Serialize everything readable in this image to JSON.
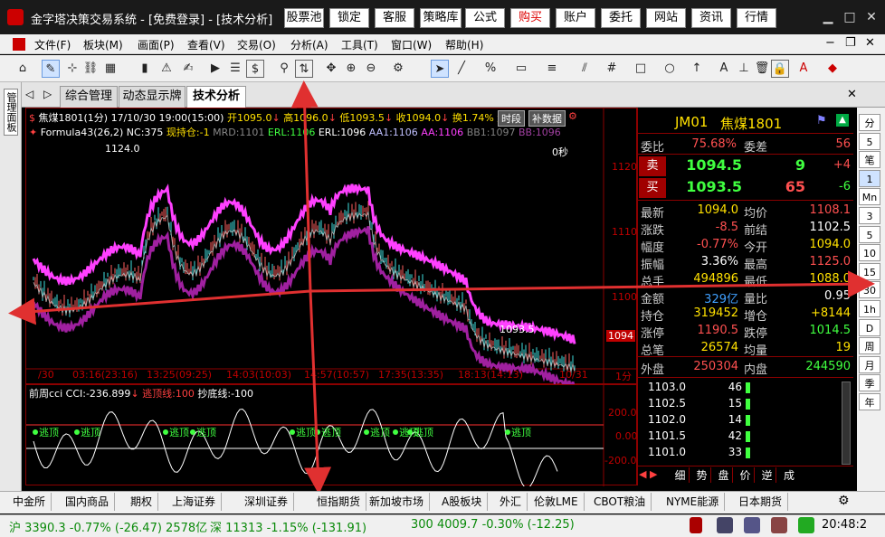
{
  "titlebar": {
    "title": "金字塔决策交易系统 - [免费登录] - [技术分析]",
    "buttons": [
      "股票池",
      "锁定",
      "客服",
      "策略库",
      "公式",
      "购买",
      "账户",
      "委托",
      "网站",
      "资讯",
      "行情"
    ]
  },
  "menu": [
    "文件(F)",
    "板块(M)",
    "画面(P)",
    "查看(V)",
    "交易(O)",
    "分析(A)",
    "工具(T)",
    "窗口(W)",
    "帮助(H)"
  ],
  "tabs": [
    "综合管理",
    "动态显示牌",
    "技术分析"
  ],
  "left_strip_label": "管理面板",
  "chart": {
    "header": "焦煤1801(1分)  17/10/30 19:00(15:00)",
    "open": "开1095.0",
    "high": "高1096.0",
    "low": "低1093.5",
    "close": "收1094.0",
    "turnover": "换1.74%",
    "qty_label": "量",
    "btn_timeshare": "时段",
    "btn_fill": "补数据",
    "formula_line": "Formula43(26,2)",
    "nc": "NC:375",
    "pos": "现持仓:-1",
    "mrd": "MRD:1101",
    "erl": "ERL:1106",
    "erl2": "ERL:1096",
    "aa1": "AA1:1106",
    "aa": "AA:1106",
    "bb1": "BB1:1097",
    "bb": "BB:1096",
    "peak_label": "1124.0",
    "low_label": "1093.5",
    "countdown": "0秒",
    "price_ticks": [
      "1120",
      "1110",
      "1100"
    ],
    "last_price_tag": "1094",
    "time_ticks": [
      "/30",
      "03:16(23:16)",
      "13:25(09:25)",
      "14:03(10:03)",
      "14:57(10:57)",
      "17:35(13:35)",
      "18:13(14:13)",
      "10/31"
    ],
    "period_unit": "1分"
  },
  "cci": {
    "title": "前周cci",
    "value": "CCI:-236.899",
    "escape": "逃顶线:100",
    "bottom": "抄底线:-100",
    "ticks": [
      "200.00",
      "0.00",
      "-200.00"
    ],
    "escape_label": "逃顶"
  },
  "quote": {
    "code": "JM01",
    "name": "焦煤1801",
    "weibi_lbl": "委比",
    "weibi": "75.68%",
    "weicha_lbl": "委差",
    "weicha": "56",
    "sell_lbl": "卖",
    "sell_price": "1094.5",
    "sell_vol": "9",
    "sell_chg": "+4",
    "buy_lbl": "买",
    "buy_price": "1093.5",
    "buy_vol": "65",
    "buy_chg": "-6",
    "rows": [
      {
        "l1": "最新",
        "v1": "1094.0",
        "l2": "均价",
        "v2": "1108.1",
        "c1": "#ffe000",
        "c2": "#ff5050"
      },
      {
        "l1": "涨跌",
        "v1": "-8.5",
        "l2": "前结",
        "v2": "1102.5",
        "c1": "#ff5050",
        "c2": "#ffffff"
      },
      {
        "l1": "幅度",
        "v1": "-0.77%",
        "l2": "今开",
        "v2": "1094.0",
        "c1": "#ff5050",
        "c2": "#ffe000"
      },
      {
        "l1": "振幅",
        "v1": "3.36%",
        "l2": "最高",
        "v2": "1125.0",
        "c1": "#ffffff",
        "c2": "#ff5050"
      },
      {
        "l1": "总手",
        "v1": "494896",
        "l2": "最低",
        "v2": "1088.0",
        "c1": "#ffe000",
        "c2": "#ffe000"
      },
      {
        "l1": "金额",
        "v1": "329亿",
        "l2": "量比",
        "v2": "0.95",
        "c1": "#40a0ff",
        "c2": "#ffffff"
      },
      {
        "l1": "持仓",
        "v1": "319452",
        "l2": "增仓",
        "v2": "+8144",
        "c1": "#ffe000",
        "c2": "#ffe000"
      },
      {
        "l1": "涨停",
        "v1": "1190.5",
        "l2": "跌停",
        "v2": "1014.5",
        "c1": "#ff5050",
        "c2": "#40ff40"
      },
      {
        "l1": "总笔",
        "v1": "26574",
        "l2": "均量",
        "v2": "19",
        "c1": "#ffe000",
        "c2": "#ffe000"
      }
    ],
    "outer_lbl": "外盘",
    "outer": "250304",
    "inner_lbl": "内盘",
    "inner": "244590",
    "ticks": [
      {
        "price": "1103.0",
        "vol": "46"
      },
      {
        "price": "1102.5",
        "vol": "15"
      },
      {
        "price": "1102.0",
        "vol": "14"
      },
      {
        "price": "1101.5",
        "vol": "42"
      },
      {
        "price": "1101.0",
        "vol": "33"
      }
    ],
    "subtabs": [
      "细",
      "势",
      "盘",
      "价",
      "逆",
      "成"
    ]
  },
  "periods": [
    "分",
    "5",
    "笔",
    "1",
    "Mn",
    "3",
    "5",
    "10",
    "15",
    "30",
    "1h",
    "D",
    "周",
    "月",
    "季",
    "年"
  ],
  "boards": [
    "中金所",
    "国内商品",
    "期权",
    "上海证券",
    "深圳证券",
    "恒指期货",
    "新加坡市场",
    "A股板块",
    "外汇",
    "伦敦LME",
    "CBOT粮油",
    "NYME能源",
    "日本期货"
  ],
  "status": {
    "sh": "沪 3390.3 -0.77% (-26.47) 2578亿",
    "sz": "深 11313 -1.15% (-131.91)",
    "hs300": "300 4009.7 -0.30% (-12.25)",
    "clock": "20:48:2"
  }
}
